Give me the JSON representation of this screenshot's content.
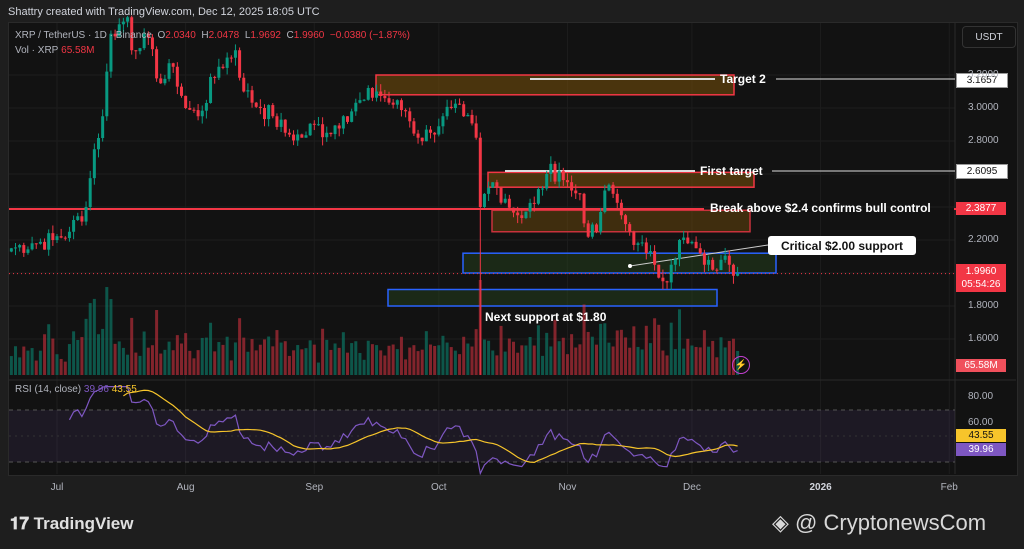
{
  "header": {
    "credit": "Shattry created with TradingView.com, Dec 12, 2025 18:05 UTC",
    "symbol": "XRP / TetherUS · 1D · Binance",
    "o_label": "O",
    "o": "2.0340",
    "h_label": "H",
    "h": "2.0478",
    "l_label": "L",
    "l": "1.9692",
    "c_label": "C",
    "c": "1.9960",
    "change": "−0.0380 (−1.87%)",
    "vol_label": "Vol · XRP",
    "vol": "65.58M",
    "currency": "USDT"
  },
  "annotations": {
    "target2": "Target 2",
    "first_target": "First target",
    "break_above": "Break above $2.4 confirms bull control",
    "critical": "Critical $2.00 support",
    "next_support": "Next support at $1.80"
  },
  "price_tags": {
    "target2": "3.1657",
    "first_target": "2.6095",
    "break": "2.3877",
    "last": "1.9960",
    "countdown": "05:54:26",
    "volume": "65.58M",
    "rsi_ma": "43.55",
    "rsi": "39.96"
  },
  "rsi": {
    "label": "RSI (14, close)",
    "value": "39.96",
    "ma": "43.55"
  },
  "footer": {
    "brand": "TradingView",
    "watermark": "@ CryptonewsCom"
  },
  "colors": {
    "up": "#089981",
    "down": "#f23645",
    "rsi": "#7e57c2",
    "rsi_ma": "#f7c52b"
  },
  "chart_data": {
    "type": "candlestick",
    "symbol": "XRPUSDT",
    "interval": "1D",
    "price_ticks": [
      "3.2000",
      "3.0000",
      "2.8000",
      "2.2000",
      "1.8000",
      "1.6000"
    ],
    "rsi_ticks": [
      "80.00",
      "60.00"
    ],
    "x_ticks": [
      "Jul",
      "Aug",
      "Sep",
      "Oct",
      "Nov",
      "Dec",
      "2026",
      "Feb"
    ],
    "close_keypoints_day_price": [
      [
        0,
        2.15
      ],
      [
        5,
        2.18
      ],
      [
        10,
        2.2
      ],
      [
        14,
        2.25
      ],
      [
        18,
        2.4
      ],
      [
        20,
        2.75
      ],
      [
        22,
        2.95
      ],
      [
        24,
        3.45
      ],
      [
        28,
        3.55
      ],
      [
        29,
        3.35
      ],
      [
        32,
        3.45
      ],
      [
        36,
        3.15
      ],
      [
        39,
        3.25
      ],
      [
        42,
        3.0
      ],
      [
        45,
        2.95
      ],
      [
        50,
        3.25
      ],
      [
        54,
        3.35
      ],
      [
        56,
        3.1
      ],
      [
        60,
        3.0
      ],
      [
        63,
        2.95
      ],
      [
        66,
        2.85
      ],
      [
        70,
        2.82
      ],
      [
        73,
        2.9
      ],
      [
        76,
        2.85
      ],
      [
        80,
        2.95
      ],
      [
        85,
        3.05
      ],
      [
        88,
        3.1
      ],
      [
        92,
        3.02
      ],
      [
        95,
        2.98
      ],
      [
        98,
        2.82
      ],
      [
        101,
        2.85
      ],
      [
        104,
        2.95
      ],
      [
        106,
        3.0
      ],
      [
        109,
        2.95
      ],
      [
        112,
        2.82
      ],
      [
        113,
        2.4
      ],
      [
        116,
        2.55
      ],
      [
        119,
        2.45
      ],
      [
        122,
        2.35
      ],
      [
        126,
        2.42
      ],
      [
        129,
        2.6
      ],
      [
        132,
        2.62
      ],
      [
        135,
        2.5
      ],
      [
        137,
        2.48
      ],
      [
        139,
        2.22
      ],
      [
        141,
        2.25
      ],
      [
        143,
        2.5
      ],
      [
        145,
        2.48
      ],
      [
        147,
        2.35
      ],
      [
        149,
        2.25
      ],
      [
        151,
        2.18
      ],
      [
        153,
        2.12
      ],
      [
        155,
        2.05
      ],
      [
        157,
        1.95
      ],
      [
        159,
        2.05
      ],
      [
        161,
        2.2
      ],
      [
        163,
        2.18
      ],
      [
        165,
        2.15
      ],
      [
        167,
        2.05
      ],
      [
        169,
        2.02
      ],
      [
        171,
        2.08
      ],
      [
        173,
        2.05
      ],
      [
        175,
        1.996
      ]
    ],
    "levels": {
      "target2_zone": [
        3.08,
        3.2
      ],
      "first_target_zone": [
        2.52,
        2.61
      ],
      "break_line": 2.3877,
      "resistance_zone": [
        2.25,
        2.38
      ],
      "critical_support_zone": [
        2.0,
        2.12
      ],
      "next_support_zone": [
        1.8,
        1.9
      ]
    }
  }
}
